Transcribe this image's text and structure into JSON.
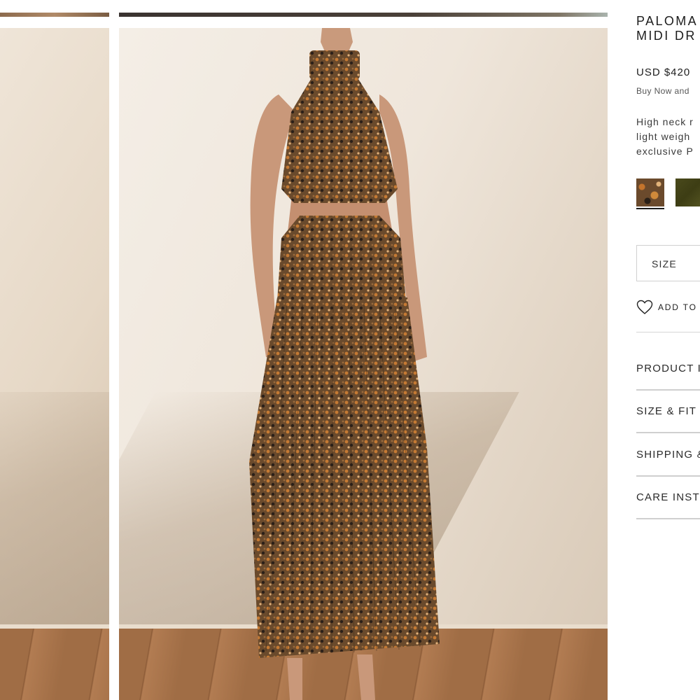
{
  "product": {
    "title_line1": "PALOMA",
    "title_line2": "MIDI DR",
    "price": "USD $420",
    "bnpl": "Buy Now and",
    "description": [
      "High neck r",
      "light weigh",
      "exclusive P"
    ]
  },
  "swatches": [
    {
      "name": "print",
      "color": "#6b4a2c",
      "selected": true
    },
    {
      "name": "olive",
      "color": "#4a4a1c",
      "selected": false
    }
  ],
  "size": {
    "label": "SIZE"
  },
  "wishlist": {
    "label": "ADD TO"
  },
  "accordion": [
    {
      "label": "PRODUCT I"
    },
    {
      "label": "SIZE & FIT"
    },
    {
      "label": "SHIPPING &"
    },
    {
      "label": "CARE INST"
    }
  ]
}
